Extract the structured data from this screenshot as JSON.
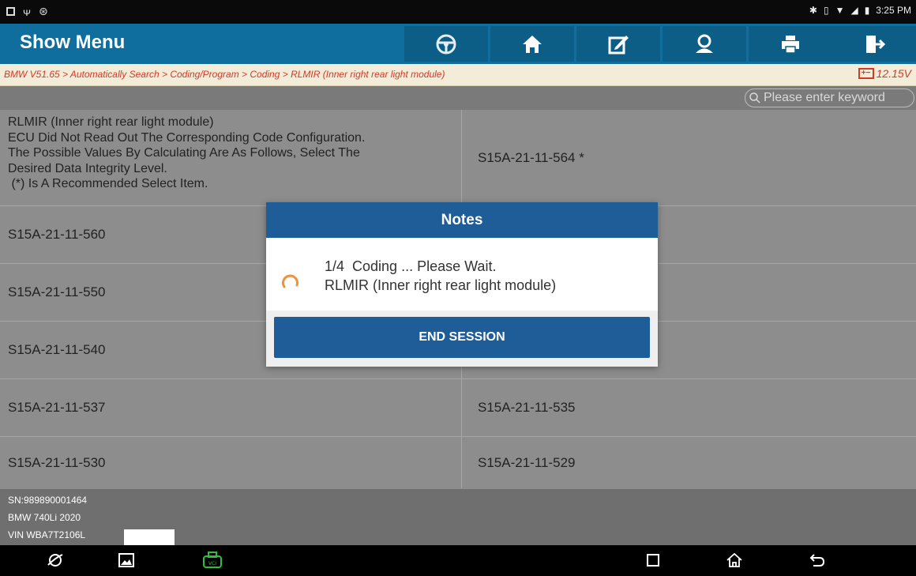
{
  "status_bar": {
    "time": "3:25 PM"
  },
  "toolbar": {
    "title": "Show Menu",
    "buttons": [
      "steering-wheel-icon",
      "home-icon",
      "edit-icon",
      "user-support-icon",
      "print-icon",
      "exit-icon"
    ]
  },
  "breadcrumb": {
    "path": "BMW V51.65 > Automatically Search > Coding/Program > Coding > RLMIR (Inner right rear light module)",
    "voltage": "12.15V"
  },
  "search": {
    "placeholder": "Please enter keyword"
  },
  "table": {
    "description_lines": [
      "RLMIR (Inner right rear light module)",
      "ECU Did Not Read Out The Corresponding Code Configuration.",
      "The Possible Values By Calculating Are As Follows, Select The",
      "Desired Data Integrity Level.",
      " (*) Is A Recommended Select Item."
    ],
    "recommended": "S15A-21-11-564 *",
    "rows": [
      {
        "left": "S15A-21-11-560",
        "right": ""
      },
      {
        "left": "S15A-21-11-550",
        "right": ""
      },
      {
        "left": "S15A-21-11-540",
        "right": ""
      },
      {
        "left": "S15A-21-11-537",
        "right": "S15A-21-11-535"
      },
      {
        "left": "S15A-21-11-530",
        "right": "S15A-21-11-529"
      }
    ]
  },
  "footer": {
    "sn": "SN:989890001464",
    "vehicle": "BMW 740Li 2020",
    "vin": "VIN WBA7T2106L"
  },
  "dialog": {
    "title": "Notes",
    "message_line1": "1/4  Coding ... Please Wait.",
    "message_line2": "RLMIR (Inner right rear light module)",
    "button": "END SESSION"
  },
  "colors": {
    "toolbar": "#0f6e9e",
    "dialog_header": "#1e5d98",
    "breadcrumb_text": "#d23a2a",
    "vci_icon": "#2fbf3a"
  }
}
